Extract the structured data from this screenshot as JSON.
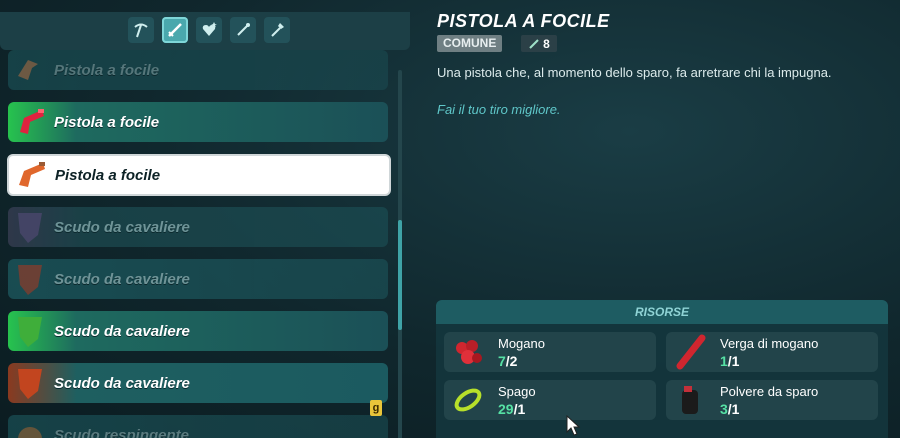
{
  "categories": [
    {
      "icon": "pickaxe-icon",
      "active": false
    },
    {
      "icon": "sword-icon",
      "active": true
    },
    {
      "icon": "heart-icon",
      "active": false
    },
    {
      "icon": "wand-icon",
      "active": false
    },
    {
      "icon": "torch-icon",
      "active": false
    }
  ],
  "recipes": [
    {
      "label": "Pistola a focile",
      "state": "dim"
    },
    {
      "label": "Pistola a focile",
      "state": "normal"
    },
    {
      "label": "Pistola a focile",
      "state": "selected"
    },
    {
      "label": "Scudo da cavaliere",
      "state": "dim"
    },
    {
      "label": "Scudo da cavaliere",
      "state": "dim"
    },
    {
      "label": "Scudo da cavaliere",
      "state": "normal"
    },
    {
      "label": "Scudo da cavaliere",
      "state": "normal"
    },
    {
      "label": "Scudo respingente",
      "state": "dim"
    }
  ],
  "key_hint": "g",
  "detail": {
    "title": "PISTOLA A FOCILE",
    "rarity": "COMUNE",
    "durability": "8",
    "description": "Una pistola che, al momento dello sparo, fa arretrare chi la impugna.",
    "flavor": "Fai il tuo tiro migliore."
  },
  "resources": {
    "header": "RISORSE",
    "items": [
      {
        "name": "Mogano",
        "have": "7",
        "need": "/2",
        "icon": "mahogany-logs-icon"
      },
      {
        "name": "Verga di mogano",
        "have": "1",
        "need": "/1",
        "icon": "mahogany-rod-icon"
      },
      {
        "name": "Spago",
        "have": "29",
        "need": "/1",
        "icon": "string-icon"
      },
      {
        "name": "Polvere da sparo",
        "have": "3",
        "need": "/1",
        "icon": "gunpowder-icon"
      }
    ]
  },
  "colors": {
    "accent": "#3fa3a7",
    "have": "#56e0a4",
    "flavor": "#5fc7c9"
  }
}
